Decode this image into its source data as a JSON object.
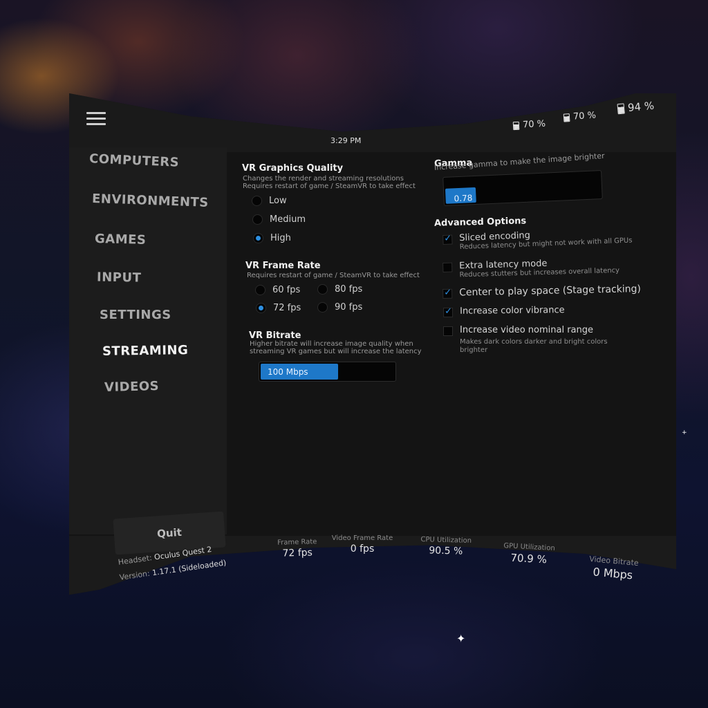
{
  "status": {
    "time": "3:29 PM",
    "batteries": [
      {
        "icon": "controller-battery-icon",
        "label": "70 %"
      },
      {
        "icon": "controller-battery-icon",
        "label": "70 %"
      },
      {
        "icon": "headset-battery-icon",
        "label": "94 %"
      }
    ]
  },
  "sidebar": {
    "items": [
      {
        "label": "COMPUTERS"
      },
      {
        "label": "ENVIRONMENTS"
      },
      {
        "label": "GAMES"
      },
      {
        "label": "INPUT"
      },
      {
        "label": "SETTINGS"
      },
      {
        "label": "STREAMING",
        "active": true
      },
      {
        "label": "VIDEOS"
      }
    ],
    "quit_label": "Quit"
  },
  "graphics": {
    "title": "VR Graphics Quality",
    "desc1": "Changes the render and streaming resolutions",
    "desc2": "Requires restart of game / SteamVR to take effect",
    "options": [
      "Low",
      "Medium",
      "High"
    ],
    "selected": "High"
  },
  "framerate": {
    "title": "VR Frame Rate",
    "desc": "Requires restart of game / SteamVR to take effect",
    "options": [
      "60 fps",
      "80 fps",
      "72 fps",
      "90 fps"
    ],
    "selected": "72 fps"
  },
  "bitrate": {
    "title": "VR Bitrate",
    "desc1": "Higher bitrate will increase image quality when",
    "desc2": "streaming VR games but will increase the latency",
    "value": "100 Mbps",
    "fill_fraction": 0.58
  },
  "gamma": {
    "title": "Gamma",
    "desc": "Increase gamma to make the image brighter",
    "value": "0.78",
    "fill_fraction": 0.2
  },
  "advanced": {
    "title": "Advanced Options",
    "items": [
      {
        "label": "Sliced encoding",
        "sub": "Reduces latency but might not work with all GPUs",
        "checked": true
      },
      {
        "label": "Extra latency mode",
        "sub": "Reduces stutters but increases overall latency",
        "checked": false
      },
      {
        "label": "Center to play space (Stage tracking)",
        "sub": "",
        "checked": true
      },
      {
        "label": "Increase color vibrance",
        "sub": "",
        "checked": true
      },
      {
        "label": "Increase video nominal range",
        "sub": "Makes dark colors darker and bright colors",
        "sub2": "brighter",
        "checked": false
      }
    ]
  },
  "footer": {
    "headset_label": "Headset:",
    "headset_value": "Oculus Quest 2",
    "version_label": "Version:",
    "version_value": "1.17.1 (Sideloaded)",
    "stats": [
      {
        "label": "Frame Rate",
        "value": "72 fps"
      },
      {
        "label": "Video Frame Rate",
        "value": "0 fps"
      },
      {
        "label": "CPU Utilization",
        "value": "90.5 %"
      },
      {
        "label": "GPU Utilization",
        "value": "70.9 %"
      },
      {
        "label": "Video Bitrate",
        "value": "0 Mbps"
      }
    ]
  },
  "colors": {
    "accent": "#1e78c8",
    "panel": "#141414",
    "sidebar": "#1c1c1c"
  }
}
